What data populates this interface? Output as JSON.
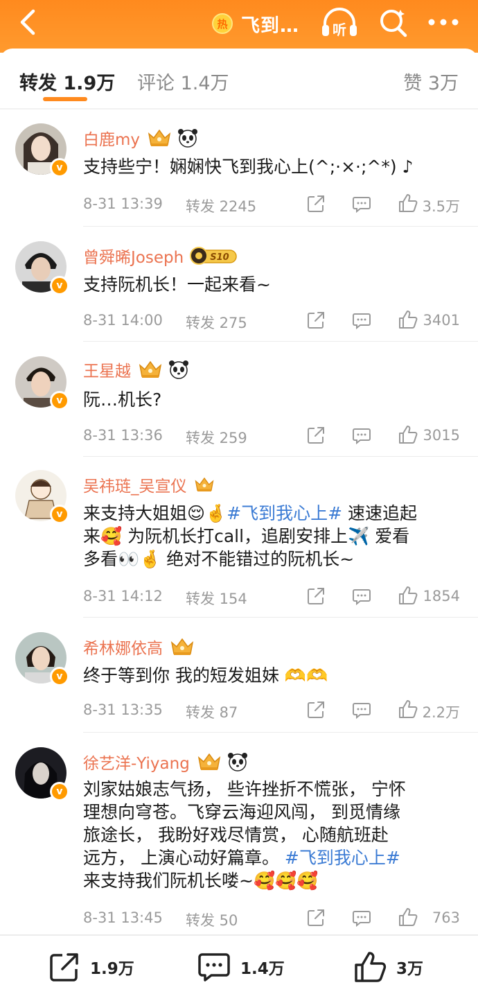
{
  "header": {
    "hot_badge": "热",
    "title": "飞到…",
    "listen_label": "听",
    "accent": "#ff8a1e"
  },
  "tabs": {
    "repost": "转发 1.9万",
    "comment": "评论 1.4万",
    "like": "赞 3万"
  },
  "posts": [
    {
      "name": "白鹿my",
      "badges": [
        "crown-icon",
        "panda-icon"
      ],
      "lines": [
        "支持些宁！娴娴快飞到我心上(^;·×·;^*) ♪"
      ],
      "date": "8-31 13:39",
      "repost": "转发 2245",
      "likes": "3.5万"
    },
    {
      "name": "曾舜晞Joseph",
      "badges": [
        "s10-badge"
      ],
      "lines": [
        "支持阮机长！一起来看~"
      ],
      "date": "8-31 14:00",
      "repost": "转发 275",
      "likes": "3401"
    },
    {
      "name": "王星越",
      "badges": [
        "crown-icon",
        "panda-icon"
      ],
      "lines": [
        "阮…机长?"
      ],
      "date": "8-31 13:36",
      "repost": "转发 259",
      "likes": "3015"
    },
    {
      "name": "吴祎琏_吴宣仪",
      "badges": [
        "crown-icon"
      ],
      "line1_a": "来支持大姐姐😌🤞",
      "topic1": "#飞到我心上#",
      "line1_b": " 速速追起",
      "line2": "来🥰 为阮机长打call，追剧安排上✈️ 爱看",
      "line3": "多看👀🤞 绝对不能错过的阮机长~",
      "date": "8-31 14:12",
      "repost": "转发 154",
      "likes": "1854"
    },
    {
      "name": "希林娜依高",
      "badges": [
        "crown-icon"
      ],
      "lines": [
        "终于等到你 我的短发姐妹 🫶🫶"
      ],
      "date": "8-31 13:35",
      "repost": "转发 87",
      "likes": "2.2万"
    },
    {
      "name": "徐艺洋-Yiyang",
      "badges": [
        "crown-icon",
        "panda-icon"
      ],
      "line1": "刘家姑娘志气扬， 些许挫折不慌张， 宁怀",
      "line2": "理想向穹苍。飞穿云海迎风闯， 到觅情缘",
      "line3": "旅途长， 我盼好戏尽情赏， 心随航班赴",
      "line4_a": "远方， 上演心动好篇章。  ",
      "topic": "#飞到我心上#",
      "line5": "来支持我们阮机长喽~🥰🥰🥰",
      "date": "8-31 13:45",
      "repost": "转发 50",
      "likes": "763"
    }
  ],
  "bottom": {
    "repost": "1.9万",
    "comment": "1.4万",
    "like": "3万"
  }
}
